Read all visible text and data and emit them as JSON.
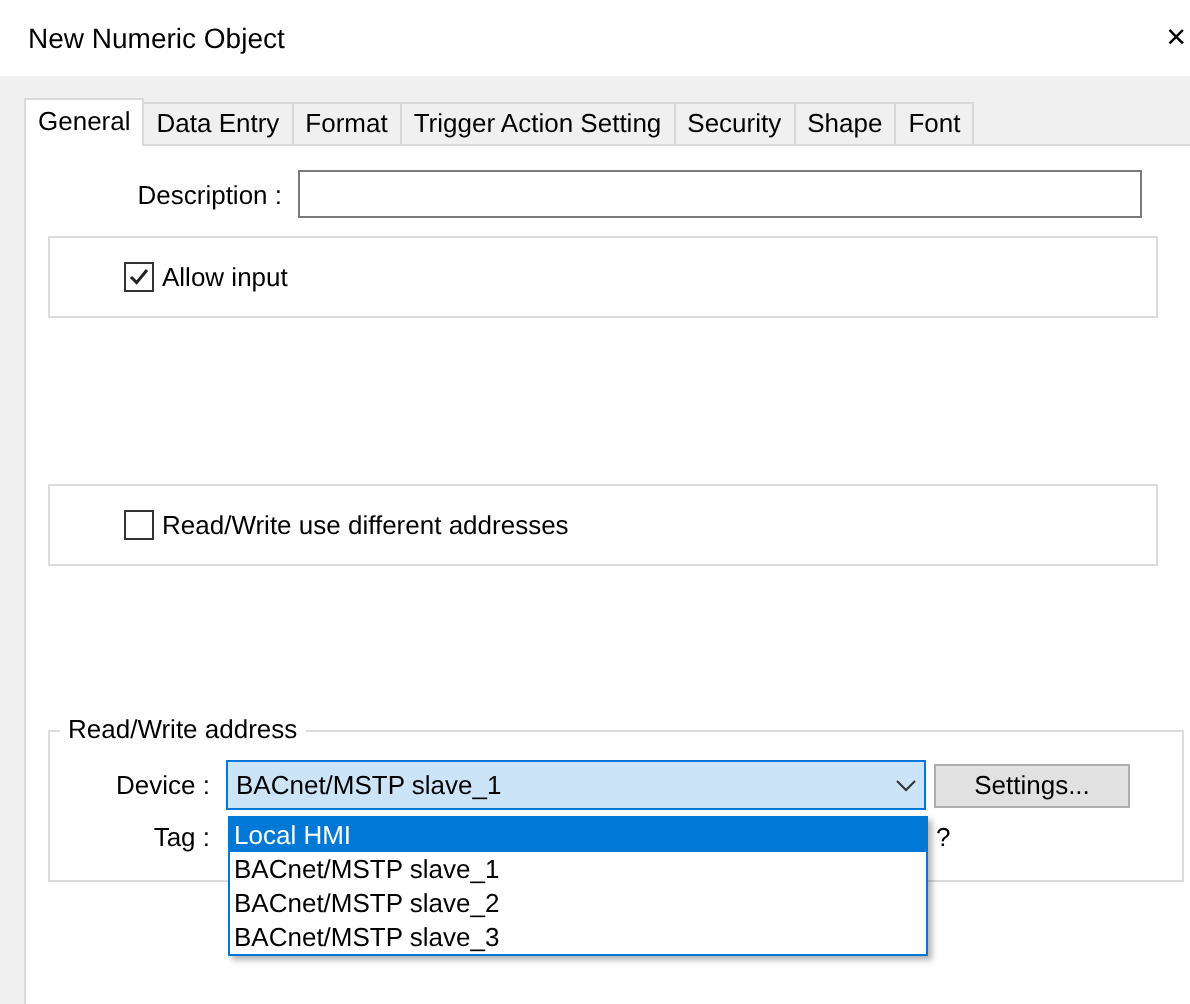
{
  "window": {
    "title": "New Numeric Object",
    "close": "×"
  },
  "tabs": [
    {
      "label": "General",
      "selected": true
    },
    {
      "label": "Data Entry",
      "selected": false
    },
    {
      "label": "Format",
      "selected": false
    },
    {
      "label": "Trigger Action Setting",
      "selected": false
    },
    {
      "label": "Security",
      "selected": false
    },
    {
      "label": "Shape",
      "selected": false
    },
    {
      "label": "Font",
      "selected": false
    }
  ],
  "description": {
    "label": "Description :"
  },
  "allow_input": {
    "label": "Allow input",
    "checked": true
  },
  "different_addresses": {
    "label": "Read/Write use different addresses",
    "checked": false
  },
  "address_group": {
    "title": "Read/Write address",
    "device_label": "Device :",
    "device_value": "BACnet/MSTP slave_1",
    "settings_button": "Settings...",
    "tag_label": "Tag :",
    "tag_tail": "?",
    "device_options": [
      {
        "label": "Local HMI",
        "selected": true
      },
      {
        "label": "BACnet/MSTP slave_1",
        "selected": false
      },
      {
        "label": "BACnet/MSTP slave_2",
        "selected": false
      },
      {
        "label": "BACnet/MSTP slave_3",
        "selected": false
      }
    ]
  }
}
